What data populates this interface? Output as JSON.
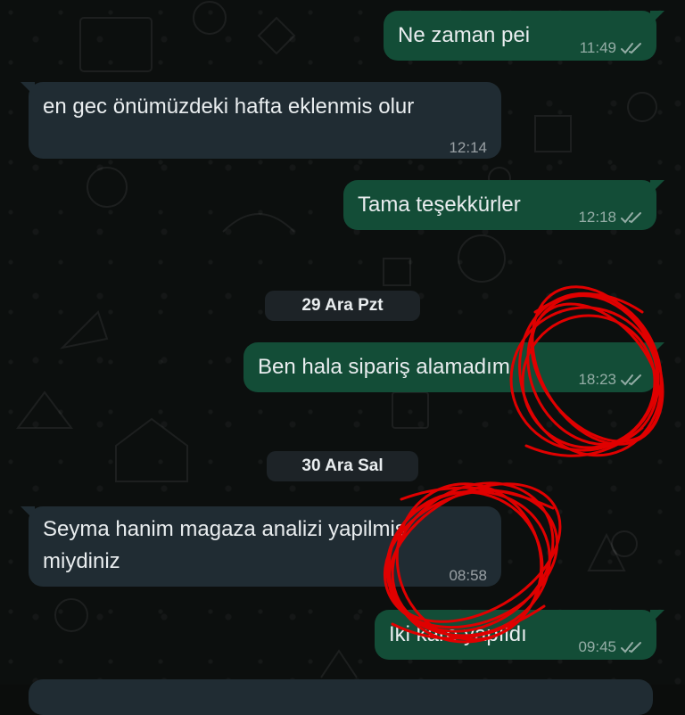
{
  "chat": {
    "messages": [
      {
        "direction": "outgoing",
        "text": "Ne zaman pei",
        "time": "11:49",
        "status": "read"
      },
      {
        "direction": "incoming",
        "text": "en gec önümüzdeki hafta eklenmis olur",
        "time": "12:14"
      },
      {
        "direction": "outgoing",
        "text": "Tama teşekkürler",
        "time": "12:18",
        "status": "read"
      },
      {
        "direction": "outgoing",
        "text": "Ben hala sipariş alamadım",
        "time": "18:23",
        "status": "read"
      },
      {
        "direction": "incoming",
        "text_line1": "Seyma hanim magaza analizi yapilmis",
        "text_line2": "miydiniz",
        "time": "08:58"
      },
      {
        "direction": "outgoing",
        "text": "Iki kare yapıldı",
        "time": "09:45",
        "status": "read"
      }
    ],
    "date_separators": [
      {
        "label": "29 Ara Pzt"
      },
      {
        "label": "30 Ara Sal"
      }
    ]
  },
  "colors": {
    "outgoing_bubble": "#134d37",
    "incoming_bubble": "#202c33",
    "scribble": "#e00000"
  },
  "icons": {
    "read_receipt": "double-check-icon"
  }
}
